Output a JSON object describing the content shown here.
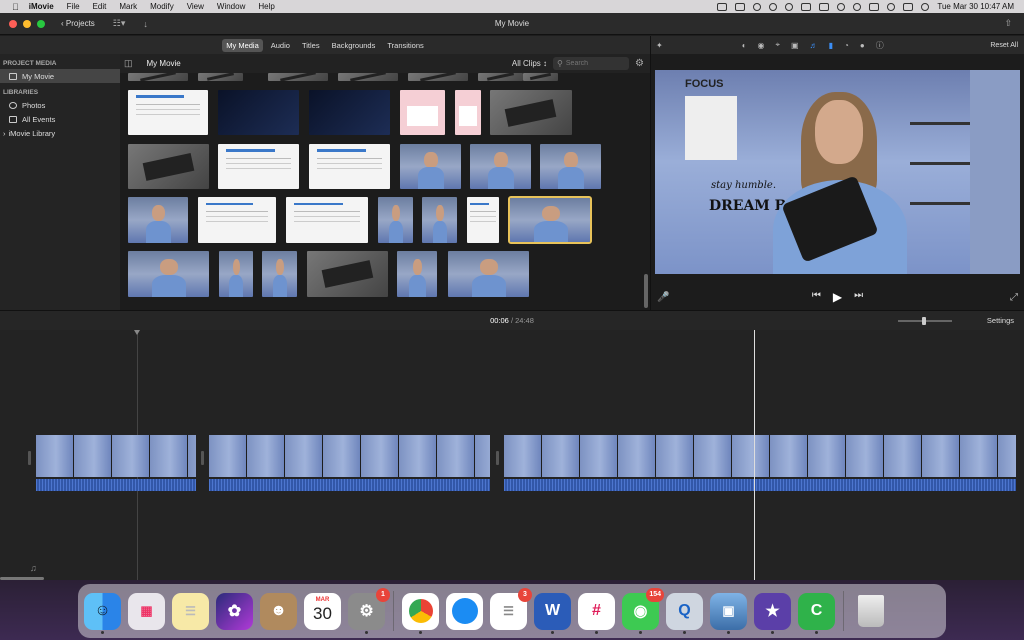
{
  "menubar": {
    "apple": "",
    "app_name": "iMovie",
    "menus": [
      "File",
      "Edit",
      "Mark",
      "Modify",
      "View",
      "Window",
      "Help"
    ],
    "clock": "Tue Mar 30  10:47 AM"
  },
  "window": {
    "title": "My Movie",
    "projects_label": "Projects"
  },
  "media_tabs": {
    "my_media": "My Media",
    "audio": "Audio",
    "titles": "Titles",
    "backgrounds": "Backgrounds",
    "transitions": "Transitions"
  },
  "sidebar": {
    "project_media_heading": "PROJECT MEDIA",
    "project_item": "My Movie",
    "libraries_heading": "LIBRARIES",
    "photos": "Photos",
    "all_events": "All Events",
    "library": "iMovie Library"
  },
  "browser": {
    "title": "My Movie",
    "filter": "All Clips",
    "search_placeholder": "Search"
  },
  "viewer": {
    "reset_all": "Reset All",
    "wall_text_top": "FOCUS",
    "wall_text_1": "stay humble.",
    "wall_text_2": "DREAM BIG"
  },
  "timeline": {
    "current_time": "00:06",
    "separator": " / ",
    "total_time": "24:48",
    "settings_label": "Settings"
  },
  "dock": {
    "calendar_month": "MAR",
    "calendar_day": "30",
    "badges": {
      "system_preferences": "1",
      "reminders": "3",
      "messages": "154"
    }
  },
  "colors": {
    "accent_blue": "#3b8ef5",
    "selection_yellow": "#e8c35a",
    "audio_blue": "#3257a8",
    "badge_red": "#e8443a"
  }
}
